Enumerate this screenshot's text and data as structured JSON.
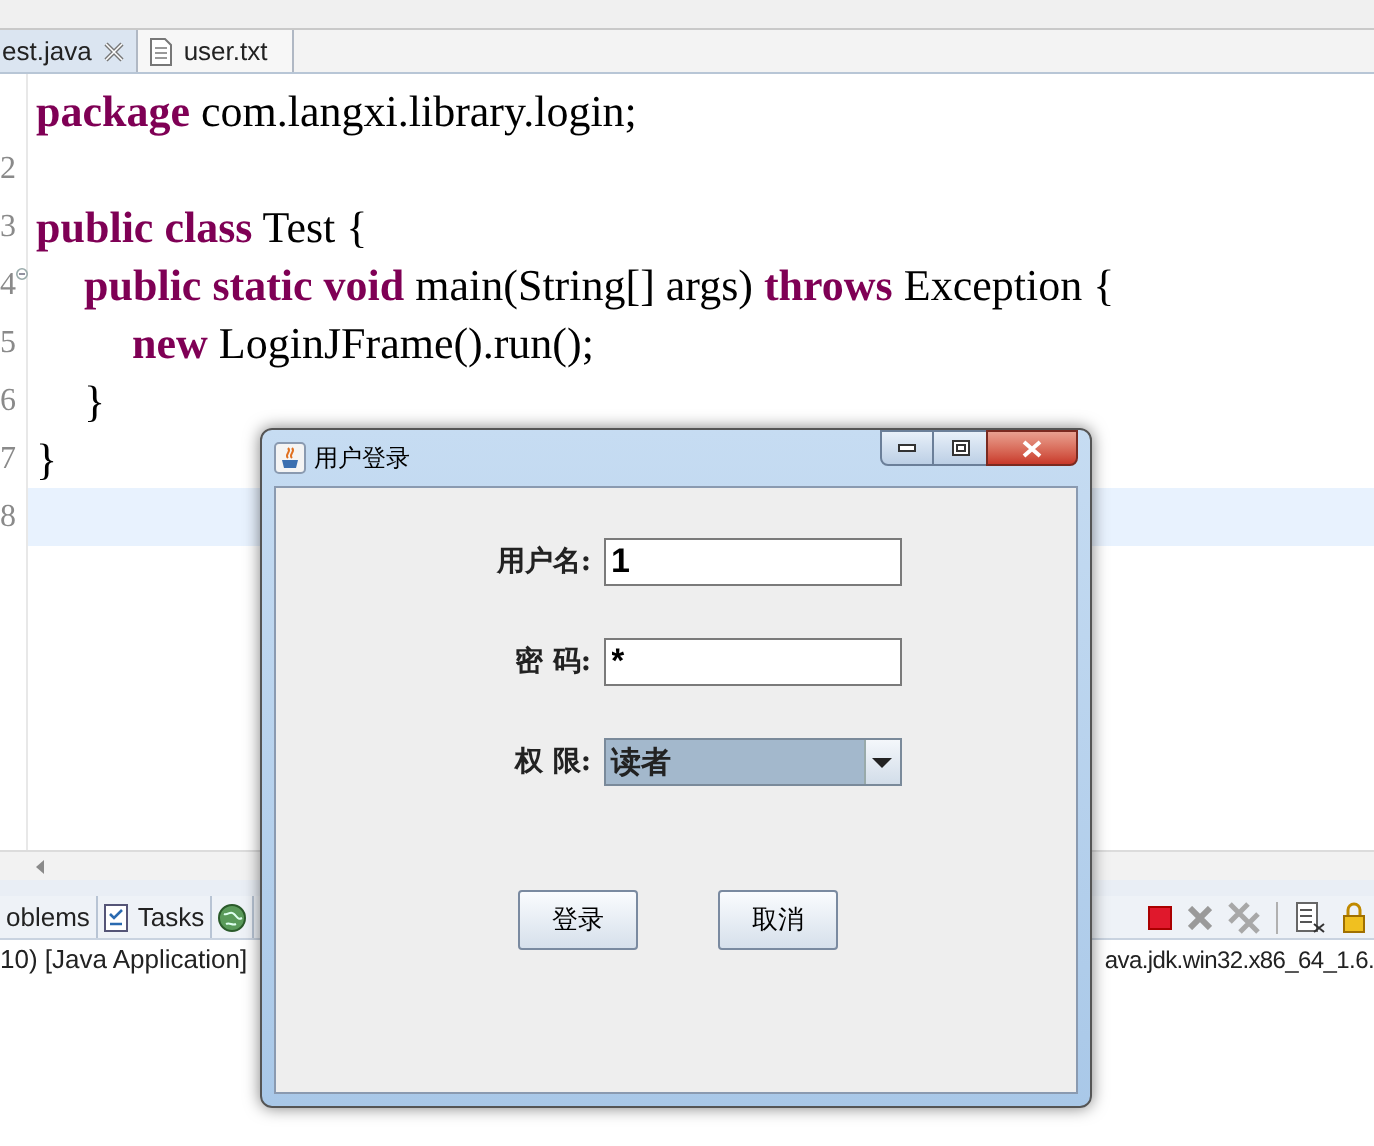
{
  "editor_tabs": [
    {
      "label": "est.java",
      "selected": true,
      "closable": true
    },
    {
      "label": "user.txt",
      "selected": false,
      "closable": false
    }
  ],
  "code_lines": [
    {
      "tokens": [
        {
          "kind": "keyword",
          "text": "package"
        },
        {
          "kind": "plain",
          "text": " com.langxi.library.login;"
        }
      ],
      "current": false
    },
    {
      "number": "2",
      "current": false
    },
    {
      "number": "3",
      "tokens": [
        {
          "kind": "keyword",
          "text": "public class"
        },
        {
          "kind": "plain",
          "text": " Test {"
        }
      ],
      "current": false
    },
    {
      "number": "4",
      "tokens": [
        {
          "kind": "keyword",
          "text": "\tpublic static void"
        },
        {
          "kind": "plain",
          "text": " main(String[] args) "
        },
        {
          "kind": "keyword",
          "text": "throws"
        },
        {
          "kind": "plain",
          "text": " Exception {"
        }
      ],
      "current": false,
      "foldable": true
    },
    {
      "number": "5",
      "tokens": [
        {
          "kind": "keyword",
          "text": "\t\tnew"
        },
        {
          "kind": "plain",
          "text": " LoginJFrame().run();"
        }
      ],
      "current": false
    },
    {
      "number": "6",
      "tokens": [
        {
          "kind": "plain",
          "text": "\t}"
        }
      ],
      "current": false
    },
    {
      "number": "7",
      "tokens": [
        {
          "kind": "plain",
          "text": "}"
        }
      ],
      "current": false
    },
    {
      "number": "8",
      "current": true
    }
  ],
  "bottom_tabs": [
    {
      "kind": "text",
      "label": "oblems"
    },
    {
      "kind": "icon_text",
      "label": "Tasks"
    },
    {
      "kind": "icon"
    }
  ],
  "console": {
    "left": "10) [Java Application]",
    "right": "ava.jdk.win32.x86_64_1.6."
  },
  "dialog": {
    "title": "用户登录",
    "fields": [
      {
        "label": "用户名:",
        "kind": "text",
        "value": "1"
      },
      {
        "label": "密 码:",
        "kind": "text",
        "value": "*"
      },
      {
        "label": "权 限:",
        "kind": "combo",
        "value": "读者"
      }
    ],
    "buttons": [
      "登录",
      "取消"
    ]
  }
}
